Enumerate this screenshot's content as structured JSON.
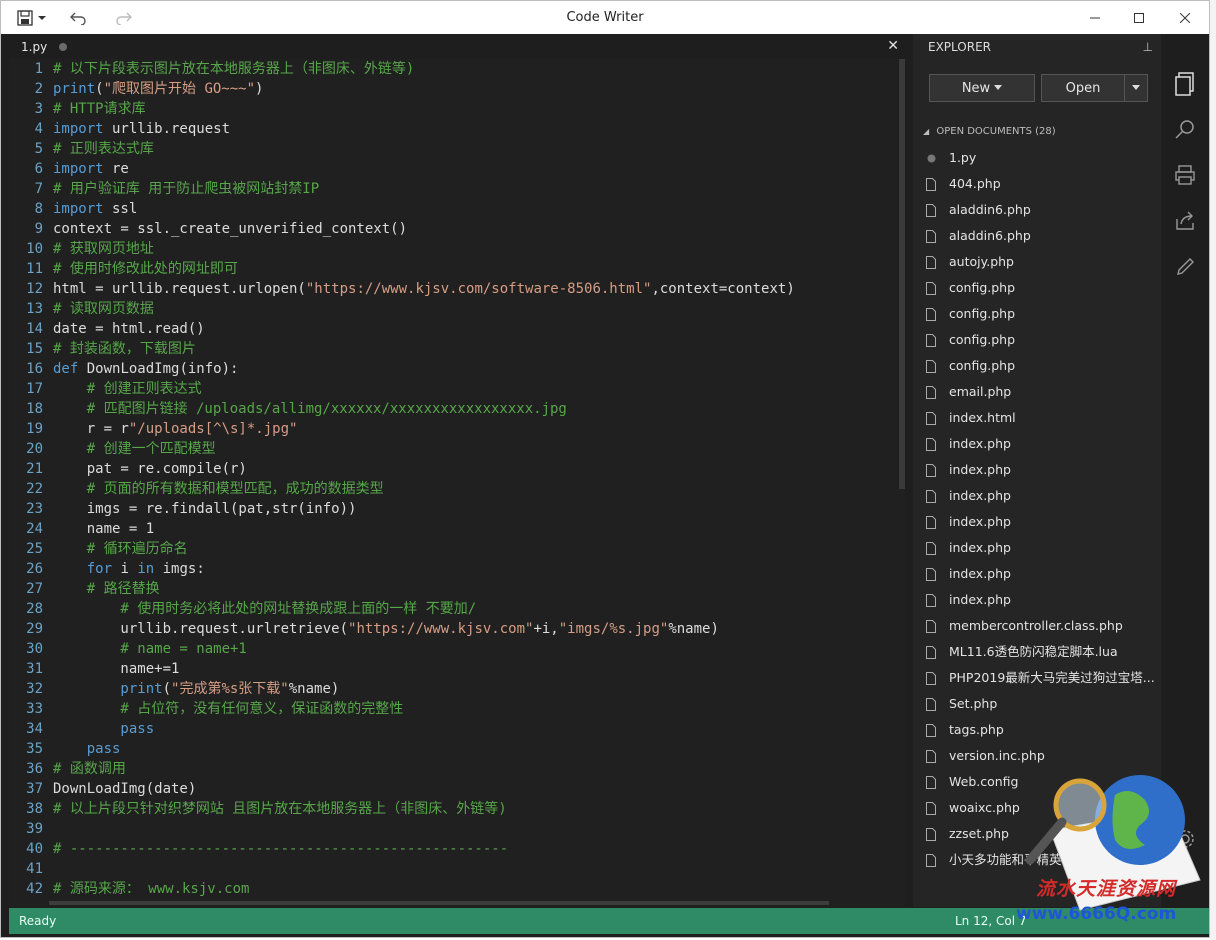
{
  "window": {
    "title": "Code Writer"
  },
  "tab": {
    "name": "1.py"
  },
  "code_lines": [
    [
      {
        "t": "# 以下片段表示图片放在本地服务器上（非图床、外链等)",
        "c": "#57a64a"
      }
    ],
    [
      {
        "t": "print",
        "c": "#569cd6"
      },
      {
        "t": "(",
        "c": "#dcdcdc"
      },
      {
        "t": "\"爬取图片开始 GO~~~\"",
        "c": "#d69d85"
      },
      {
        "t": ")",
        "c": "#dcdcdc"
      }
    ],
    [
      {
        "t": "# HTTP请求库",
        "c": "#57a64a"
      }
    ],
    [
      {
        "t": "import",
        "c": "#569cd6"
      },
      {
        "t": " urllib.request",
        "c": "#dcdcdc"
      }
    ],
    [
      {
        "t": "# 正则表达式库",
        "c": "#57a64a"
      }
    ],
    [
      {
        "t": "import",
        "c": "#569cd6"
      },
      {
        "t": " re",
        "c": "#dcdcdc"
      }
    ],
    [
      {
        "t": "# 用户验证库 用于防止爬虫被网站封禁IP",
        "c": "#57a64a"
      }
    ],
    [
      {
        "t": "import",
        "c": "#569cd6"
      },
      {
        "t": " ssl",
        "c": "#dcdcdc"
      }
    ],
    [
      {
        "t": "context = ssl._create_unverified_context()",
        "c": "#dcdcdc"
      }
    ],
    [
      {
        "t": "# 获取网页地址",
        "c": "#57a64a"
      }
    ],
    [
      {
        "t": "# 使用时修改此处的网址即可",
        "c": "#57a64a"
      }
    ],
    [
      {
        "t": "html = urllib.request.urlopen(",
        "c": "#dcdcdc"
      },
      {
        "t": "\"https://www.kjsv.com/software-8506.html\"",
        "c": "#d69d85"
      },
      {
        "t": ",context=context)",
        "c": "#dcdcdc"
      }
    ],
    [
      {
        "t": "# 读取网页数据",
        "c": "#57a64a"
      }
    ],
    [
      {
        "t": "date = html.read()",
        "c": "#dcdcdc"
      }
    ],
    [
      {
        "t": "# 封装函数，下载图片",
        "c": "#57a64a"
      }
    ],
    [
      {
        "t": "def",
        "c": "#569cd6"
      },
      {
        "t": " DownLoadImg(info):",
        "c": "#dcdcdc"
      }
    ],
    [
      {
        "t": "    # 创建正则表达式",
        "c": "#57a64a"
      }
    ],
    [
      {
        "t": "    # 匹配图片链接 /uploads/allimg/xxxxxx/xxxxxxxxxxxxxxxxx.jpg",
        "c": "#57a64a"
      }
    ],
    [
      {
        "t": "    r = r",
        "c": "#dcdcdc"
      },
      {
        "t": "\"/uploads[^\\s]*.jpg\"",
        "c": "#d69d85"
      }
    ],
    [
      {
        "t": "    # 创建一个匹配模型",
        "c": "#57a64a"
      }
    ],
    [
      {
        "t": "    pat = re.compile(r)",
        "c": "#dcdcdc"
      }
    ],
    [
      {
        "t": "    # 页面的所有数据和模型匹配，成功的数据类型",
        "c": "#57a64a"
      }
    ],
    [
      {
        "t": "    imgs = re.findall(pat,str(info))",
        "c": "#dcdcdc"
      }
    ],
    [
      {
        "t": "    name = 1",
        "c": "#dcdcdc"
      }
    ],
    [
      {
        "t": "    # 循环遍历命名",
        "c": "#57a64a"
      }
    ],
    [
      {
        "t": "    ",
        "c": "#dcdcdc"
      },
      {
        "t": "for",
        "c": "#569cd6"
      },
      {
        "t": " i ",
        "c": "#dcdcdc"
      },
      {
        "t": "in",
        "c": "#569cd6"
      },
      {
        "t": " imgs:",
        "c": "#dcdcdc"
      }
    ],
    [
      {
        "t": "    # 路径替换",
        "c": "#57a64a"
      }
    ],
    [
      {
        "t": "        # 使用时务必将此处的网址替换成跟上面的一样 不要加/",
        "c": "#57a64a"
      }
    ],
    [
      {
        "t": "        urllib.request.urlretrieve(",
        "c": "#dcdcdc"
      },
      {
        "t": "\"https://www.kjsv.com\"",
        "c": "#d69d85"
      },
      {
        "t": "+i,",
        "c": "#dcdcdc"
      },
      {
        "t": "\"imgs/%s.jpg\"",
        "c": "#d69d85"
      },
      {
        "t": "%name)",
        "c": "#dcdcdc"
      }
    ],
    [
      {
        "t": "        # name = name+1",
        "c": "#57a64a"
      }
    ],
    [
      {
        "t": "        name+=1",
        "c": "#dcdcdc"
      }
    ],
    [
      {
        "t": "        print",
        "c": "#569cd6"
      },
      {
        "t": "(",
        "c": "#dcdcdc"
      },
      {
        "t": "\"完成第%s张下载\"",
        "c": "#d69d85"
      },
      {
        "t": "%name)",
        "c": "#dcdcdc"
      }
    ],
    [
      {
        "t": "        # 占位符，没有任何意义，保证函数的完整性",
        "c": "#57a64a"
      }
    ],
    [
      {
        "t": "        pass",
        "c": "#569cd6"
      }
    ],
    [
      {
        "t": "    pass",
        "c": "#569cd6"
      }
    ],
    [
      {
        "t": "# 函数调用",
        "c": "#57a64a"
      }
    ],
    [
      {
        "t": "DownLoadImg(date)",
        "c": "#dcdcdc"
      }
    ],
    [
      {
        "t": "# 以上片段只针对织梦网站 且图片放在本地服务器上（非图床、外链等)",
        "c": "#57a64a"
      }
    ],
    [],
    [
      {
        "t": "# ----------------------------------------------------",
        "c": "#57a64a"
      }
    ],
    [],
    [
      {
        "t": "# 源码来源： www.ksjv.com",
        "c": "#57a64a"
      }
    ]
  ],
  "sidebar": {
    "header": "EXPLORER",
    "new_label": "New",
    "open_label": "Open",
    "open_docs_header": "OPEN DOCUMENTS (28)",
    "files": [
      "1.py",
      "404.php",
      "aladdin6.php",
      "aladdin6.php",
      "autojy.php",
      "config.php",
      "config.php",
      "config.php",
      "config.php",
      "email.php",
      "index.html",
      "index.php",
      "index.php",
      "index.php",
      "index.php",
      "index.php",
      "index.php",
      "index.php",
      "membercontroller.class.php",
      "ML11.6透色防闪稳定脚本.lua",
      "PHP2019最新大马完美过狗过宝塔...",
      "Set.php",
      "tags.php",
      "version.inc.php",
      "Web.config",
      "woaixc.php",
      "zzset.php",
      "小天多功能和平精英.lua"
    ]
  },
  "status": {
    "left": "Ready",
    "right": "Ln 12, Col 7"
  },
  "watermark": {
    "text": "流水天涯资源网",
    "url": "www.6666Q.com"
  },
  "colors": {
    "accent_status": "#2e8b66",
    "editor_bg": "#202020",
    "sidebar_bg": "#252526"
  }
}
